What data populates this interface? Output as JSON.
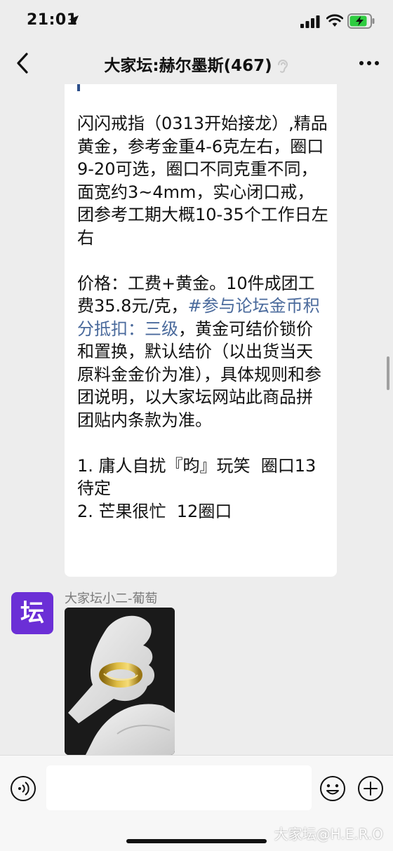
{
  "status_bar": {
    "time": "21:01"
  },
  "nav": {
    "title": "大家坛:赫尔墨斯(467)"
  },
  "message": {
    "text_part1": "闪闪戒指（0313开始接龙）,精品黄金，参考金重4-6克左右，圈口9-20可选，圈口不同克重不同，面宽约3~4mm，实心闭口戒，团参考工期大概10-35个工作日左右\n\n价格：工费+黄金。10件成团工费35.8元/克，",
    "hashtag": "#参与论坛金币积分抵扣：三级",
    "text_part2": "，黄金可结价锁价和置换，默认结价（以出货当天原料金金价为准），具体规则和参团说明，以大家坛网站此商品拼团贴内条款为准。\n\n1. 庸人自扰『昀』玩笑  圈口13待定\n2. 芒果很忙  12圈口"
  },
  "sender": {
    "avatar_char": "坛",
    "name": "大家坛小二-葡萄"
  },
  "watermark": "大家坛@H.E.R.O",
  "colors": {
    "background": "#ededed",
    "bubble": "#ffffff",
    "link": "#4a6a9c",
    "avatar": "#6b2fd6"
  }
}
